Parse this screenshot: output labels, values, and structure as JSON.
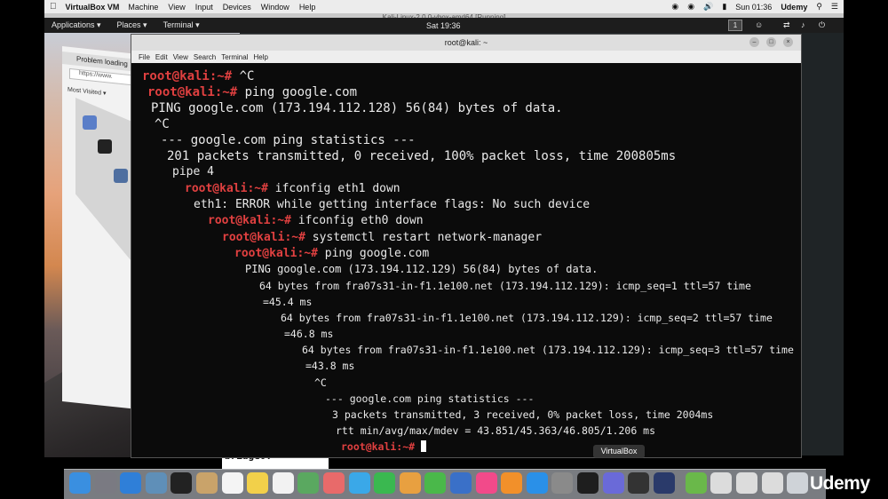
{
  "mac_menubar": {
    "app_name": "VirtualBox VM",
    "menus": [
      "Machine",
      "View",
      "Input",
      "Devices",
      "Window",
      "Help"
    ],
    "clock": "Sun 01:36",
    "user": "Udemy"
  },
  "vm": {
    "title": "Kali-Linux-2.0.0-vbox-amd64 [Running]",
    "gnome": {
      "applications": "Applications ▾",
      "places": "Places ▾",
      "terminal": "Terminal ▾",
      "clock": "Sat 19:36",
      "workspace": "1"
    }
  },
  "browser": {
    "tab": "Problem loading",
    "url": "https://www.",
    "bookmark": "Most Visited ▾"
  },
  "terminal": {
    "title": "root@kali: ~",
    "menus": [
      "File",
      "Edit",
      "View",
      "Search",
      "Terminal",
      "Help"
    ],
    "lines": [
      {
        "prompt": "root@kali:~# ",
        "text": "^C"
      },
      {
        "prompt": "root@kali:~# ",
        "text": "ping google.com"
      },
      {
        "prompt": "",
        "text": "PING google.com (173.194.112.128) 56(84) bytes of data."
      },
      {
        "prompt": "",
        "text": "^C"
      },
      {
        "prompt": "",
        "text": "--- google.com ping statistics ---"
      },
      {
        "prompt": "",
        "text": "201 packets transmitted, 0 received, 100% packet loss, time 200805ms"
      },
      {
        "prompt": "",
        "text": "pipe 4"
      },
      {
        "prompt": "root@kali:~# ",
        "text": "ifconfig eth1 down"
      },
      {
        "prompt": "",
        "text": "eth1: ERROR while getting interface flags: No such device"
      },
      {
        "prompt": "root@kali:~# ",
        "text": "ifconfig eth0 down"
      },
      {
        "prompt": "root@kali:~# ",
        "text": "systemctl restart network-manager"
      },
      {
        "prompt": "root@kali:~# ",
        "text": "ping google.com"
      },
      {
        "prompt": "",
        "text": "PING google.com (173.194.112.129) 56(84) bytes of data."
      },
      {
        "prompt": "",
        "text": "64 bytes from fra07s31-in-f1.1e100.net (173.194.112.129): icmp_seq=1 ttl=57 time"
      },
      {
        "prompt": "",
        "text": "=45.4 ms"
      },
      {
        "prompt": "",
        "text": "64 bytes from fra07s31-in-f1.1e100.net (173.194.112.129): icmp_seq=2 ttl=57 time"
      },
      {
        "prompt": "",
        "text": "=46.8 ms"
      },
      {
        "prompt": "",
        "text": "64 bytes from fra07s31-in-f1.1e100.net (173.194.112.129): icmp_seq=3 ttl=57 time"
      },
      {
        "prompt": "",
        "text": "=43.8 ms"
      },
      {
        "prompt": "",
        "text": "^C"
      },
      {
        "prompt": "",
        "text": "--- google.com ping statistics ---"
      },
      {
        "prompt": "",
        "text": "3 packets transmitted, 3 received, 0% packet loss, time 2004ms"
      },
      {
        "prompt": "",
        "text": "rtt min/avg/max/mdev = 43.851/45.363/46.805/1.206 ms"
      },
      {
        "prompt": "root@kali:~# ",
        "text": ""
      }
    ]
  },
  "bridge": {
    "label": "bridge0:"
  },
  "dock": {
    "tooltip": "VirtualBox",
    "icons": [
      "finder-icon",
      "launchpad-icon",
      "safari-icon",
      "preview-icon",
      "terminal-icon",
      "contacts-icon",
      "calendar-icon",
      "notes-icon",
      "reminders-icon",
      "maps-icon",
      "photos-icon",
      "messages-icon",
      "facetime-icon",
      "pages-icon",
      "numbers-icon",
      "keynote-icon",
      "itunes-icon",
      "ibooks-icon",
      "appstore-icon",
      "preferences-icon",
      "activity-monitor-icon",
      "virtualbox-icon",
      "screen-icon",
      "quicktime-icon",
      "package-icon",
      "finder-window-icon",
      "download-icon",
      "mail-window-icon",
      "trash-icon"
    ]
  },
  "watermark": "Udemy",
  "colors": {
    "prompt": "#e04040",
    "terminal_bg": "#0b0b0b",
    "terminal_text": "#e9e9e9"
  }
}
